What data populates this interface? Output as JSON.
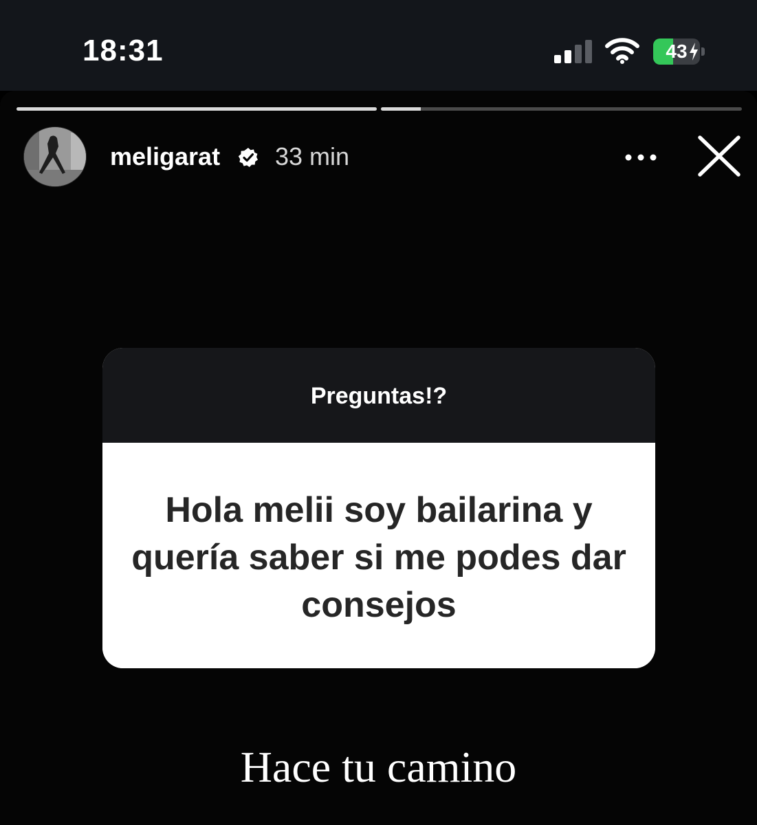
{
  "status_bar": {
    "time": "18:31",
    "battery_level": "43",
    "battery_percent": 43,
    "signal_icon": "cellular-signal-icon",
    "wifi_icon": "wifi-icon",
    "charging_icon": "bolt-icon"
  },
  "story": {
    "progress": [
      1.0,
      0.11
    ],
    "user": {
      "username": "meligarat",
      "verified_icon": "verified-badge-icon",
      "time_ago": "33 min"
    },
    "actions": {
      "more_icon": "more-dots-icon",
      "close_icon": "close-icon"
    },
    "question_sticker": {
      "title": "Preguntas!?",
      "question": "Hola melii soy bailarina y quería saber si me podes dar consejos"
    },
    "caption": "Hace tu camino"
  },
  "colors": {
    "background": "#000000",
    "status_bar_bg": "#13161b",
    "battery_green": "#34c759",
    "card_header_bg": "#16171a",
    "card_body_bg": "#ffffff",
    "question_text": "#262626"
  }
}
